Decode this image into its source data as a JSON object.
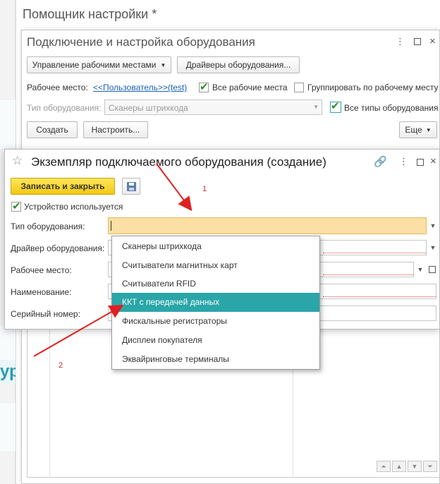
{
  "assistant": {
    "title": "Помощник настройки *"
  },
  "equipment_window": {
    "title": "Подключение и настройка оборудования",
    "buttons": {
      "workplaces": "Управление рабочими местами",
      "drivers": "Драйверы оборудования..."
    },
    "workplace_label": "Рабочее место:",
    "workplace_link": "<<Пользователь>>(test)",
    "all_workplaces": "Все рабочие места",
    "group_by_workplace": "Группировать по рабочему месту",
    "type_label": "Тип оборудования:",
    "type_value": "Сканеры штрихкода",
    "all_types": "Все типы оборудования",
    "create": "Создать",
    "configure": "Настроить...",
    "more": "Еще"
  },
  "dialog": {
    "title": "Экземпляр подключаемого оборудования (создание)",
    "save_close": "Записать и закрыть",
    "device_used": "Устройство используется",
    "fields": {
      "type": "Тип оборудования:",
      "driver": "Драйвер оборудования:",
      "workplace": "Рабочее место:",
      "name": "Наименование:",
      "serial": "Серийный номер:"
    }
  },
  "dropdown": {
    "items": [
      "Сканеры штрихкода",
      "Считыватели магнитных карт",
      "Считыватели RFID",
      "ККТ с передачей данных",
      "Фискальные регистраторы",
      "Дисплеи покупателя",
      "Эквайринговые терминалы"
    ],
    "selected_index": 3
  },
  "annotations": {
    "arrow1": "1",
    "arrow2": "2"
  },
  "colors": {
    "accent": "#2aa6a8",
    "highlight": "#fbdfa4",
    "primary_button": "#f3c814",
    "annotation": "#d42a2a"
  },
  "icons": [
    "star-icon",
    "link-icon",
    "more-icon",
    "maximize-icon",
    "close-icon",
    "save-icon",
    "dropdown-arrow-icon"
  ]
}
